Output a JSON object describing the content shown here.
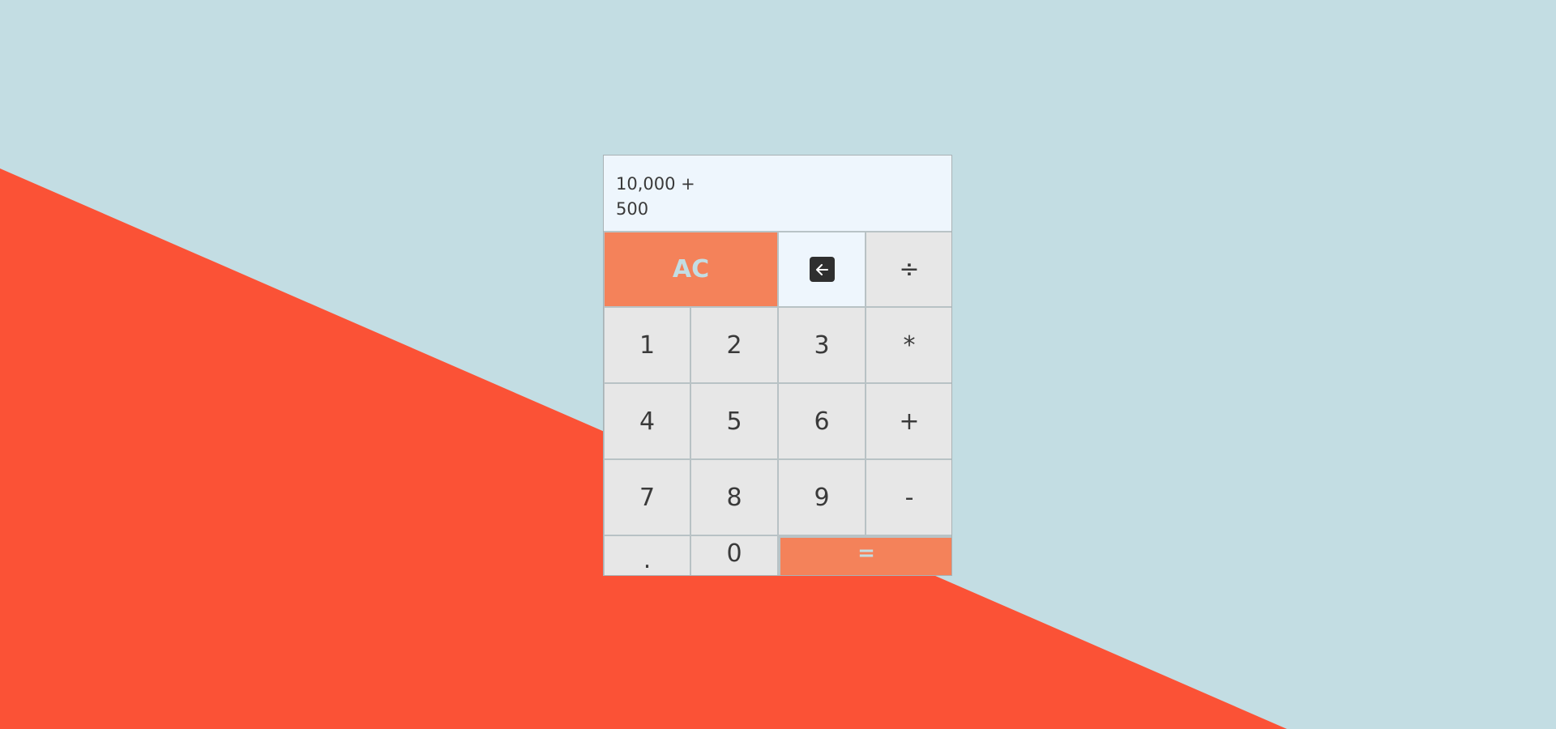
{
  "display": {
    "expression": "10,000 +",
    "current": "500"
  },
  "keys": {
    "clear": "AC",
    "backspace_icon": "arrow-left-icon",
    "divide": "÷",
    "one": "1",
    "two": "2",
    "three": "3",
    "multiply": "*",
    "four": "4",
    "five": "5",
    "six": "6",
    "plus": "+",
    "seven": "7",
    "eight": "8",
    "nine": "9",
    "minus": "-",
    "decimal": ".",
    "zero": "0",
    "equals": "="
  },
  "colors": {
    "background_blue": "#c3dde3",
    "background_red": "#fb5236",
    "accent_orange": "#f4825a",
    "key_gray": "#e7e7e7",
    "display_bg": "#eef6fd"
  }
}
